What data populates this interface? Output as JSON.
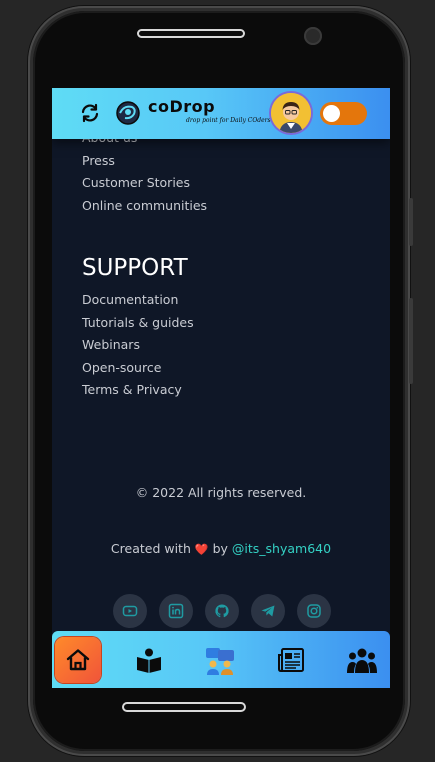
{
  "header": {
    "logo_main": "coDrop",
    "logo_tagline": "drop point for Daily COders",
    "theme_toggle": "off"
  },
  "company": {
    "links": [
      "About us",
      "Press",
      "Customer Stories",
      "Online communities"
    ]
  },
  "support": {
    "heading": "SUPPORT",
    "links": [
      "Documentation",
      "Tutorials & guides",
      "Webinars",
      "Open-source",
      "Terms & Privacy"
    ]
  },
  "footer": {
    "copyright": "© 2022 All rights reserved.",
    "created_with": "Created with",
    "heart": "❤️",
    "by": "by",
    "handle": "@its_shyam640"
  },
  "socials": [
    "youtube-icon",
    "linkedin-icon",
    "github-icon",
    "telegram-icon",
    "instagram-icon"
  ],
  "bottom_nav": [
    "home-icon",
    "reader-icon",
    "community-icon",
    "newspaper-icon",
    "team-icon"
  ],
  "colors": {
    "header_gradient_start": "#5fdcf5",
    "header_gradient_end": "#3b8ff0",
    "background": "#0f1727",
    "accent_orange": "#e4760c",
    "handle_teal": "#34d1c4",
    "social_icon": "#1f9ba2"
  }
}
